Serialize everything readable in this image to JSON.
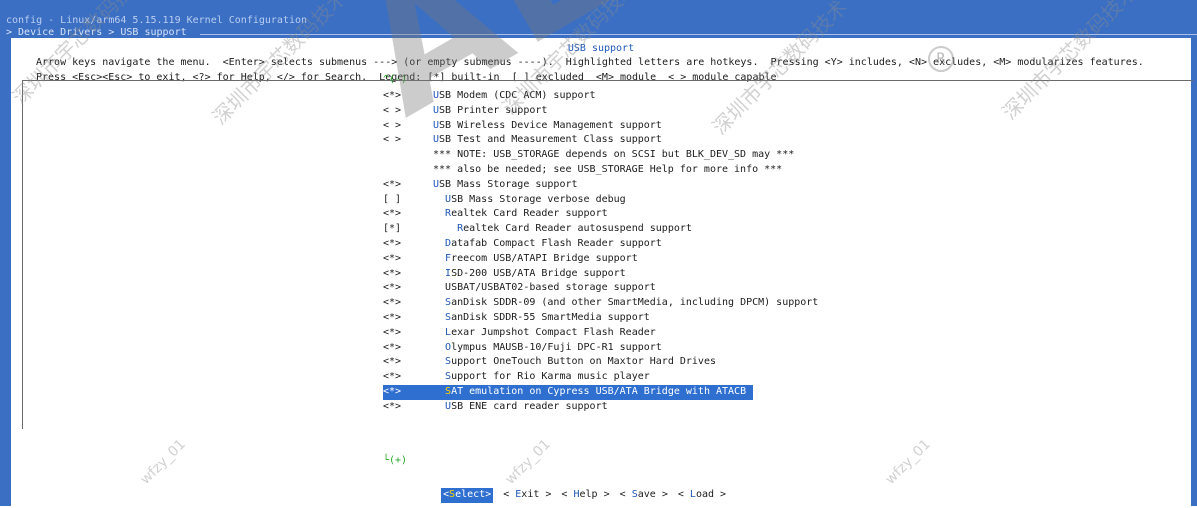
{
  "window": {
    "title": "config - Linux/arm64 5.15.119 Kernel Configuration",
    "breadcrumb": "> Device Drivers > USB support "
  },
  "dialog": {
    "title": "USB support",
    "help_line1": "Arrow keys navigate the menu.  <Enter> selects submenus ---> (or empty submenus ----).  Highlighted letters are hotkeys.  Pressing <Y> includes, <N> excludes, <M> modularizes features.",
    "help_line2": "Press <Esc><Esc> to exit, <?> for Help, </> for Search.  Legend: [*] built-in  [ ] excluded  <M> module  < > module capable",
    "scroll_up": "^(-)",
    "scroll_down": "└(+)"
  },
  "menu": {
    "items": [
      {
        "box": "<*>",
        "indent": "",
        "hk": "U",
        "rest": "SB Modem (CDC ACM) support"
      },
      {
        "box": "< >",
        "indent": "",
        "hk": "U",
        "rest": "SB Printer support"
      },
      {
        "box": "< >",
        "indent": "",
        "hk": "U",
        "rest": "SB Wireless Device Management support"
      },
      {
        "box": "< >",
        "indent": "",
        "hk": "U",
        "rest": "SB Test and Measurement Class support"
      },
      {
        "box": "",
        "indent": "",
        "hk": "",
        "rest": "*** NOTE: USB_STORAGE depends on SCSI but BLK_DEV_SD may ***"
      },
      {
        "box": "",
        "indent": "",
        "hk": "",
        "rest": "*** also be needed; see USB_STORAGE Help for more info ***"
      },
      {
        "box": "<*>",
        "indent": "",
        "hk": "U",
        "rest": "SB Mass Storage support"
      },
      {
        "box": "[ ]",
        "indent": "  ",
        "hk": "U",
        "rest": "SB Mass Storage verbose debug"
      },
      {
        "box": "<*>",
        "indent": "  ",
        "hk": "R",
        "rest": "ealtek Card Reader support"
      },
      {
        "box": "[*]",
        "indent": "    ",
        "hk": "R",
        "rest": "ealtek Card Reader autosuspend support"
      },
      {
        "box": "<*>",
        "indent": "  ",
        "hk": "D",
        "rest": "atafab Compact Flash Reader support"
      },
      {
        "box": "<*>",
        "indent": "  ",
        "hk": "F",
        "rest": "reecom USB/ATAPI Bridge support"
      },
      {
        "box": "<*>",
        "indent": "  ",
        "hk": "I",
        "rest": "SD-200 USB/ATA Bridge support"
      },
      {
        "box": "<*>",
        "indent": "  ",
        "hk": "",
        "rest": "USBAT/USBAT02-based storage support"
      },
      {
        "box": "<*>",
        "indent": "  ",
        "hk": "S",
        "rest": "anDisk SDDR-09 (and other SmartMedia, including DPCM) support"
      },
      {
        "box": "<*>",
        "indent": "  ",
        "hk": "S",
        "rest": "anDisk SDDR-55 SmartMedia support"
      },
      {
        "box": "<*>",
        "indent": "  ",
        "hk": "L",
        "rest": "exar Jumpshot Compact Flash Reader"
      },
      {
        "box": "<*>",
        "indent": "  ",
        "hk": "O",
        "rest": "lympus MAUSB-10/Fuji DPC-R1 support"
      },
      {
        "box": "<*>",
        "indent": "  ",
        "hk": "S",
        "rest": "upport OneTouch Button on Maxtor Hard Drives"
      },
      {
        "box": "<*>",
        "indent": "  ",
        "hk": "S",
        "rest": "upport for Rio Karma music player"
      },
      {
        "box": "<*>",
        "indent": "  ",
        "hk": "S",
        "rest": "AT emulation on Cypress USB/ATA Bridge with ATACB"
      },
      {
        "box": "<*>",
        "indent": "  ",
        "hk": "U",
        "rest": "SB ENE card reader support"
      }
    ],
    "selected_index": 20
  },
  "buttons": [
    {
      "hk": "S",
      "rest": "elect",
      "active": true
    },
    {
      "hk": "E",
      "rest": "xit",
      "active": false
    },
    {
      "hk": "H",
      "rest": "elp",
      "active": false
    },
    {
      "hk": "S",
      "rest": "ave",
      "active": false
    },
    {
      "hk": "L",
      "rest": "oad",
      "active": false
    }
  ],
  "watermark": {
    "logo_text": "ALLWINNER",
    "cjk_text": "深圳市宇芯数码技术",
    "id_text": "wfzy_01"
  },
  "colors": {
    "terminal_bg": "#3b6fc3",
    "hotkey": "#1f57b8",
    "selection_bg": "#2f6fd0",
    "selection_hotkey": "#ffd400",
    "scroll_indicator": "#2aa52a"
  }
}
